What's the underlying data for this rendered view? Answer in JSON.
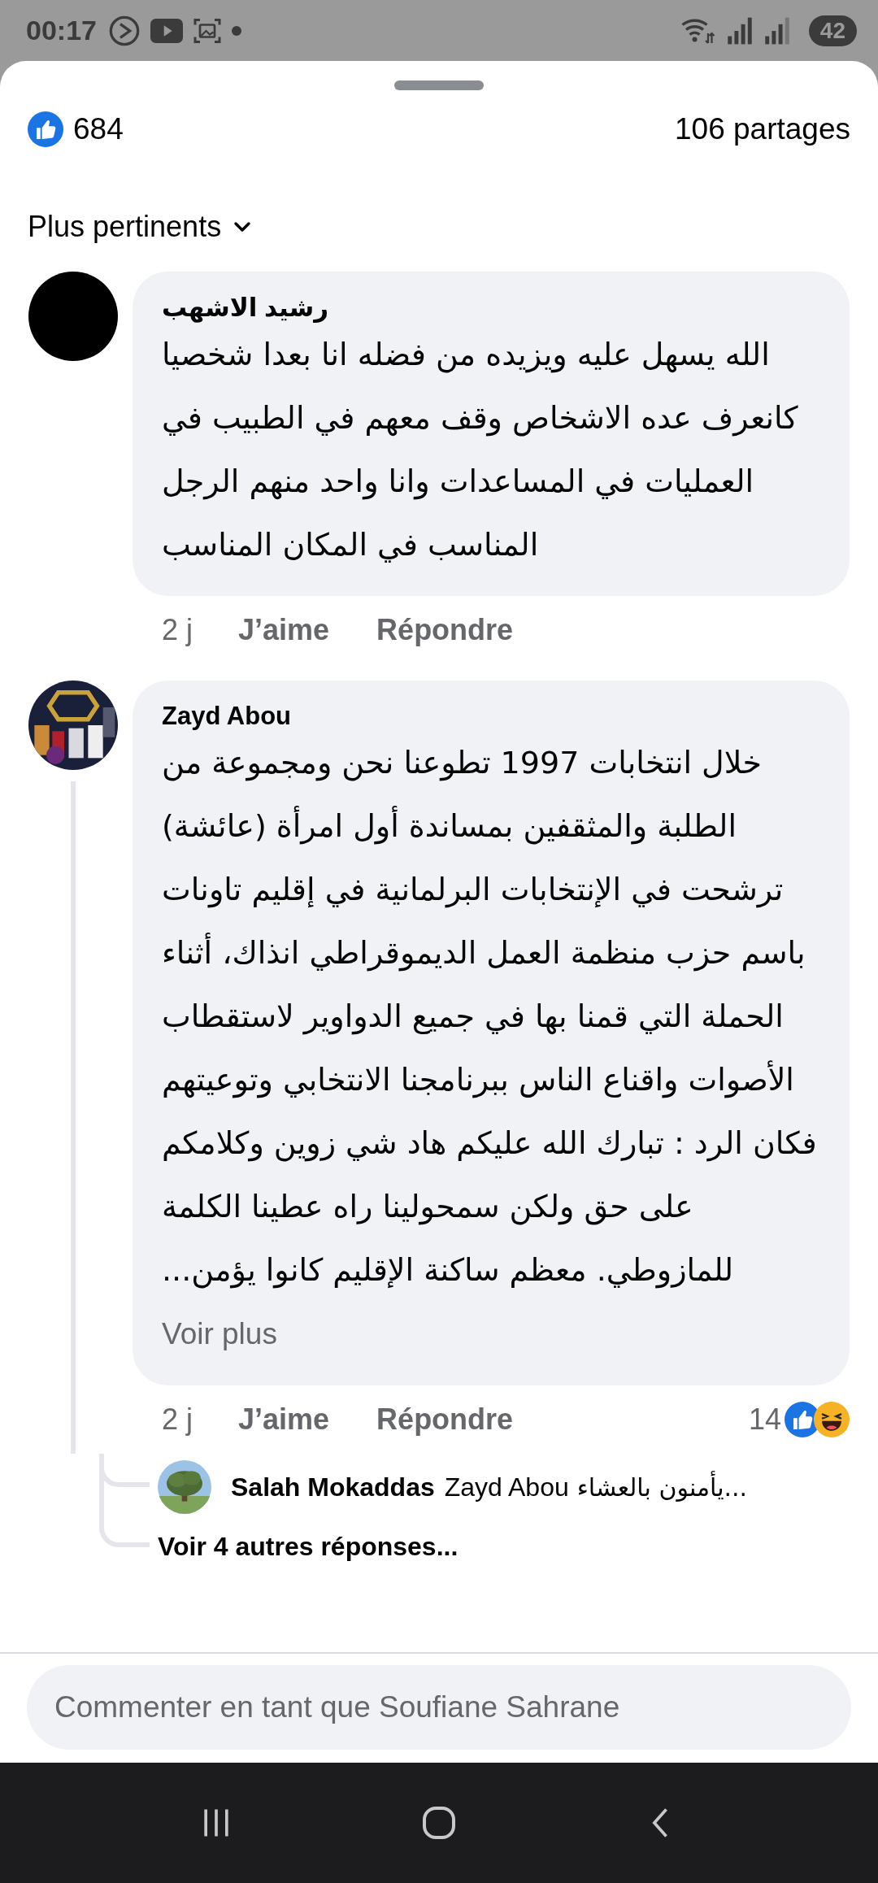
{
  "status_bar": {
    "time": "00:17",
    "battery": "42"
  },
  "post_stats": {
    "reactions": "684",
    "shares": "106 partages"
  },
  "sort": {
    "label": "Plus pertinents"
  },
  "comments": [
    {
      "author": "رشيد الاشهب",
      "avatar": {
        "kind": "plain"
      },
      "text": "الله يسهل عليه ويزيده من فضله انا بعدا شخصيا كانعرف عده الاشخاص وقف معهم في الطبيب في العمليات في المساعدات وانا واحد منهم الرجل المناسب في المكان المناسب",
      "time": "2 j",
      "like_label": "J’aime",
      "reply_label": "Répondre"
    },
    {
      "author": "Zayd Abou",
      "avatar": {
        "kind": "picture"
      },
      "text": "خلال انتخابات 1997 تطوعنا نحن ومجموعة من الطلبة والمثقفين بمساندة أول امرأة (عائشة) ترشحت في الإنتخابات البرلمانية في إقليم تاونات باسم حزب منظمة العمل الديموقراطي انذاك، أثناء الحملة التي قمنا بها في جميع الدواوير لاستقطاب الأصوات واقناع الناس ببرنامجنا الانتخابي وتوعيتهم فكان الرد : تبارك الله عليكم هاد شي زوين وكلامكم على حق ولكن سمحولينا راه عطينا الكلمة للمازوطي. معظم ساكنة الإقليم كانوا يؤمن...",
      "more_label": "Voir plus",
      "time": "2 j",
      "like_label": "J’aime",
      "reply_label": "Répondre",
      "reaction_count": "14",
      "replies": [
        {
          "author": "Salah Mokaddas",
          "avatar": {
            "kind": "picture"
          },
          "mention": "Zayd Abou",
          "text": "يأمنون بالعشاء..."
        }
      ],
      "more_replies": "Voir 4 autres réponses..."
    }
  ],
  "composer": {
    "placeholder": "Commenter en tant que Soufiane Sahrane"
  }
}
